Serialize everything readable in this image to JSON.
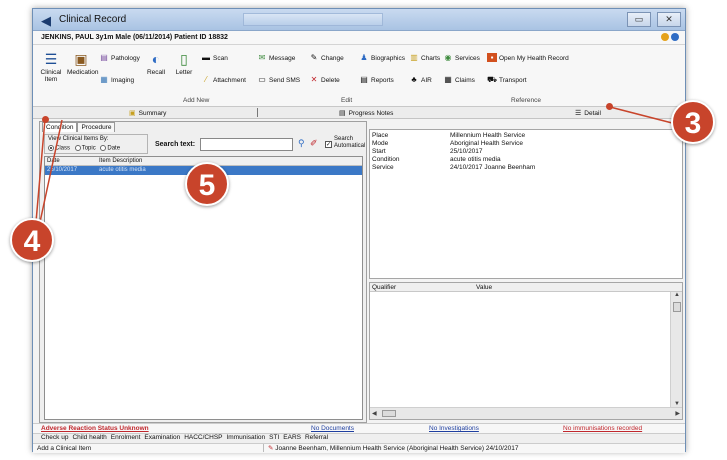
{
  "window": {
    "title": "Clinical Record",
    "controls": [
      "▭",
      "✕"
    ]
  },
  "patient": {
    "label": "JENKINS, PAUL 3y1m Male (06/11/2014) Patient ID 18832"
  },
  "ribbon": {
    "big_buttons": [
      {
        "label": "Clinical Item",
        "icon": "list-icon"
      },
      {
        "label": "Medication",
        "icon": "medication-icon"
      },
      {
        "label": "Recall",
        "icon": "recall-icon"
      },
      {
        "label": "Letter",
        "icon": "letter-icon"
      }
    ],
    "items": {
      "pathology": "Pathology",
      "imaging": "Imaging",
      "scan": "Scan",
      "attachment": "Attachment",
      "message": "Message",
      "send_sms": "Send SMS",
      "change": "Change",
      "delete": "Delete",
      "biographics": "Biographics",
      "charts": "Charts",
      "services": "Services",
      "open_my_health_record": "Open My Health Record",
      "reports": "Reports",
      "air": "AIR",
      "claims": "Claims",
      "transport": "Transport"
    },
    "groups": {
      "add_new": "Add New",
      "edit": "Edit",
      "reference": "Reference"
    }
  },
  "subtabs": {
    "summary": "Summary",
    "progress_notes": "Progress Notes",
    "detail": "Detail"
  },
  "left": {
    "tabs": [
      "Condition",
      "Procedure"
    ],
    "view_by_label": "View Clinical Items By:",
    "view_options": [
      "Class",
      "Topic",
      "Date"
    ],
    "search_label": "Search text:",
    "search_value": "",
    "search_auto_label_1": "Search",
    "search_auto_label_2": "Automatical",
    "columns": [
      "Date",
      "Item Description"
    ],
    "rows": [
      {
        "date": "25/10/2017",
        "desc": "acute otitis media"
      }
    ]
  },
  "detail": {
    "rows": [
      {
        "k": "Place",
        "v": "Millennium Health Service"
      },
      {
        "k": "Mode",
        "v": "Aboriginal Health Service"
      },
      {
        "k": "Start",
        "v": "25/10/2017"
      },
      {
        "k": "Condition",
        "v": "acute otitis media"
      },
      {
        "k": "Service",
        "v": "24/10/2017 Joanne Beenham"
      }
    ],
    "qualifier_columns": [
      "Qualifier",
      "Value"
    ]
  },
  "status": {
    "adverse": "Adverse Reaction Status Unknown",
    "documents": "No Documents",
    "investigations": "No Investigations",
    "immunisations": "No immunisations recorded"
  },
  "quicktabs": [
    "Check up",
    "Child health",
    "Enrolment",
    "Examination",
    "HACC/CHSP",
    "Immunisation",
    "STI",
    "EARS",
    "Referral"
  ],
  "bottom": {
    "add": "Add a Clinical Item",
    "clinician": "Joanne Beenham, Millennium Health Service (Aboriginal Health Service) 24/10/2017"
  },
  "callouts": {
    "three": "3",
    "four": "4",
    "five": "5"
  },
  "colors": {
    "callout": "#c8442b",
    "selection": "#3b78c6",
    "alert_red": "#c0272d",
    "link_blue": "#1f3fa0"
  }
}
